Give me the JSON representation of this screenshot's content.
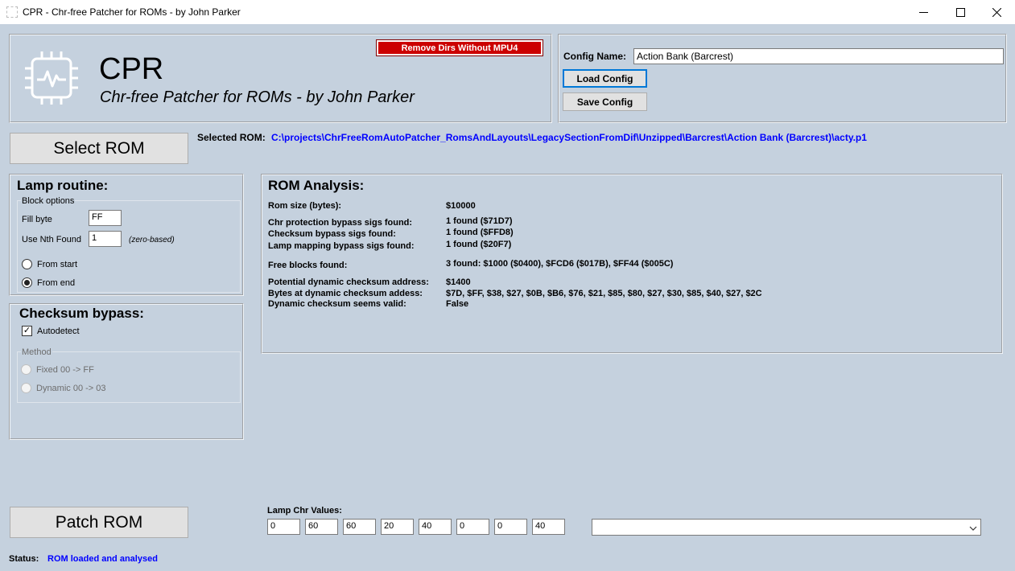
{
  "window": {
    "title": "CPR - Chr-free Patcher for ROMs - by John Parker",
    "minimize_icon": "minimize-icon",
    "maximize_icon": "maximize-icon",
    "close_icon": "close-icon"
  },
  "header": {
    "app_name": "CPR",
    "subtitle": "Chr-free Patcher for ROMs - by John Parker",
    "remove_dirs_button": "Remove Dirs Without MPU4",
    "logo_icon": "chip-pulse-icon"
  },
  "config": {
    "name_label": "Config Name:",
    "name_value": "Action Bank (Barcrest)",
    "load_button": "Load Config",
    "save_button": "Save Config"
  },
  "rom": {
    "select_button": "Select ROM",
    "selected_label": "Selected ROM:",
    "selected_path": "C:\\projects\\ChrFreeRomAutoPatcher_RomsAndLayouts\\LegacySectionFromDif\\Unzipped\\Barcrest\\Action Bank (Barcrest)\\acty.p1"
  },
  "lamp_routine": {
    "title": "Lamp routine:",
    "block_options_label": "Block options",
    "fill_byte_label": "Fill byte",
    "fill_byte_value": "FF",
    "nth_label": "Use Nth Found",
    "nth_value": "1",
    "nth_hint": "(zero-based)",
    "from_start_label": "From start",
    "from_end_label": "From end",
    "selected": "From end"
  },
  "checksum_bypass": {
    "title": "Checksum bypass:",
    "autodetect_label": "Autodetect",
    "autodetect_checked": true,
    "method_label": "Method",
    "fixed_label": "Fixed 00 -> FF",
    "dynamic_label": "Dynamic 00 -> 03"
  },
  "analysis": {
    "title": "ROM Analysis:",
    "rows": [
      {
        "label": "Rom size (bytes):",
        "value": "$10000"
      },
      {
        "label": "Chr protection bypass sigs found:",
        "value": "1 found ($71D7)"
      },
      {
        "label": "Checksum bypass sigs found:",
        "value": "1 found ($FFD8)"
      },
      {
        "label": "Lamp mapping bypass sigs found:",
        "value": "1 found ($20F7)"
      },
      {
        "label": "Free blocks found:",
        "value": "3 found: $1000 ($0400), $FCD6 ($017B), $FF44 ($005C)"
      },
      {
        "label": "Potential dynamic checksum address:",
        "value": "$1400"
      },
      {
        "label": "Bytes at dynamic checksum addess:",
        "value": "$7D, $FF, $38, $27, $0B, $B6, $76, $21, $85, $80, $27, $30, $85, $40, $27, $2C"
      },
      {
        "label": "Dynamic checksum seems valid:",
        "value": "False"
      }
    ]
  },
  "patch": {
    "button": "Patch ROM",
    "lamp_chr_label": "Lamp Chr Values:",
    "lamp_chr_values": [
      "0",
      "60",
      "60",
      "20",
      "40",
      "0",
      "0",
      "40"
    ],
    "dropdown_value": "",
    "dropdown_icon": "chevron-down-icon"
  },
  "status": {
    "label": "Status:",
    "text": "ROM loaded and analysed"
  },
  "colors": {
    "background": "#c5d1de",
    "danger_button": "#cc0000",
    "link_blue": "#0000ff"
  }
}
